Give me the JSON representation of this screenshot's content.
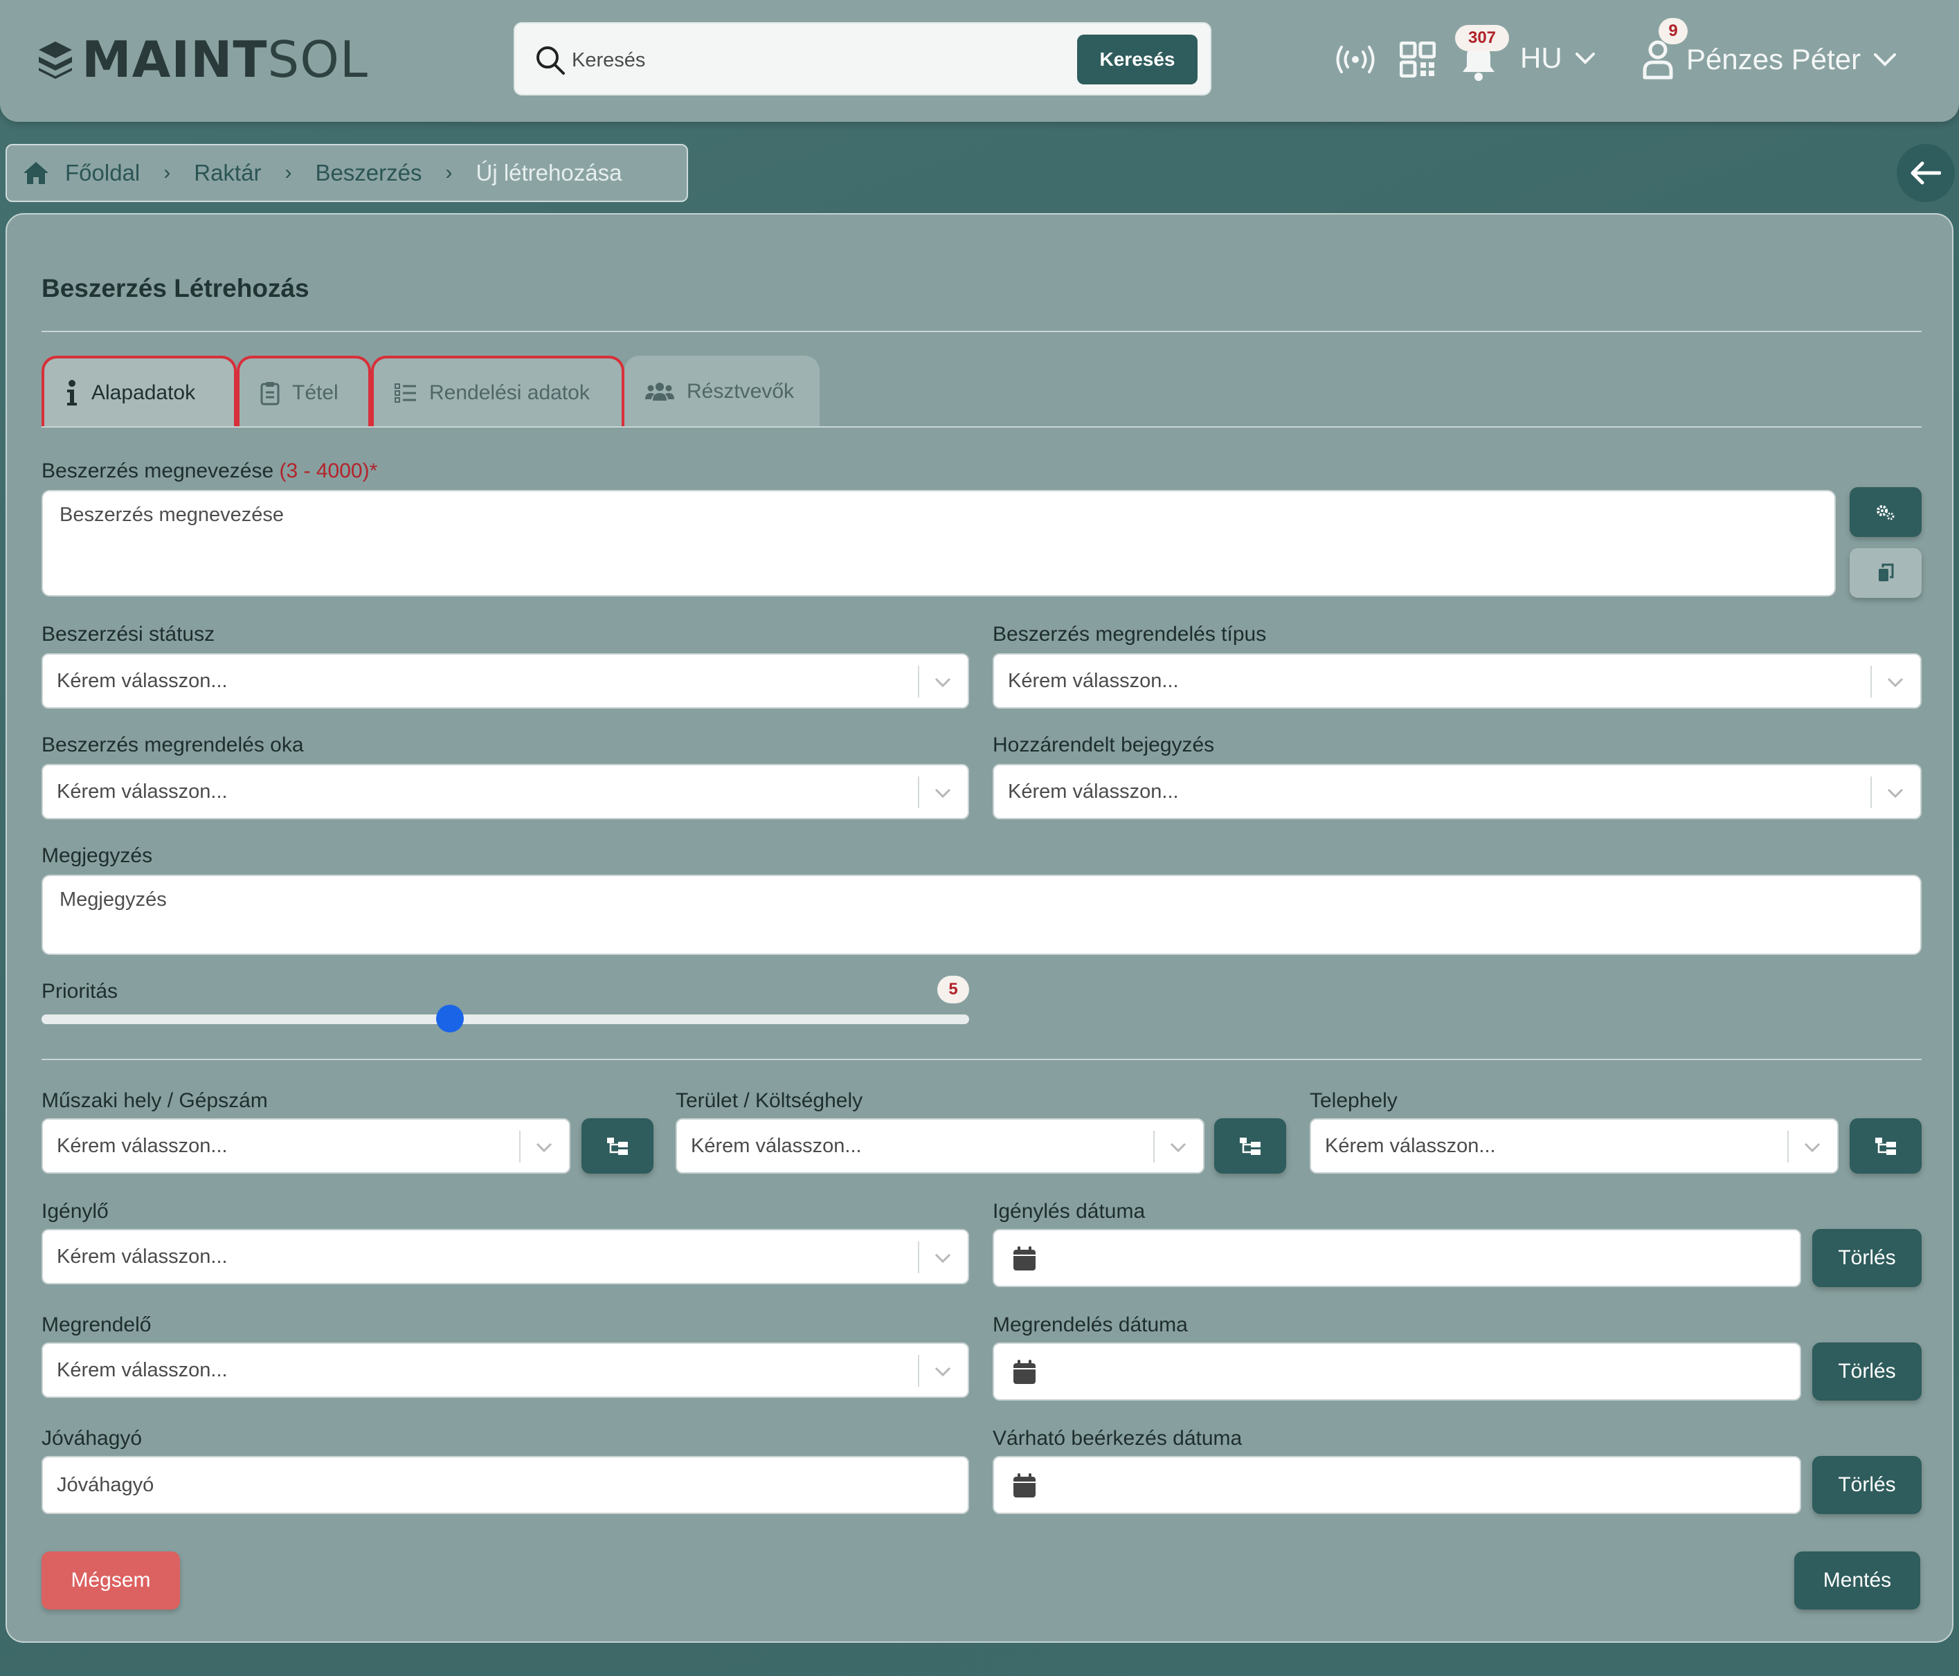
{
  "header": {
    "logo_bold": "MAINT",
    "logo_light": "SOL",
    "search_placeholder": "Keresés",
    "search_button": "Keresés",
    "notification_count": "307",
    "language": "HU",
    "user_badge": "9",
    "user_name": "Pénzes Péter"
  },
  "breadcrumb": {
    "items": [
      "Főoldal",
      "Raktár",
      "Beszerzés",
      "Új létrehozása"
    ]
  },
  "page": {
    "title": "Beszerzés Létrehozás"
  },
  "tabs": [
    {
      "label": "Alapadatok",
      "icon": "info-icon"
    },
    {
      "label": "Tétel",
      "icon": "clipboard-icon"
    },
    {
      "label": "Rendelési adatok",
      "icon": "list-icon"
    },
    {
      "label": "Résztvevők",
      "icon": "users-icon"
    }
  ],
  "form": {
    "name_label": "Beszerzés megnevezése",
    "name_hint": "(3 - 4000)*",
    "name_placeholder": "Beszerzés megnevezése",
    "status_label": "Beszerzési státusz",
    "order_type_label": "Beszerzés megrendelés típus",
    "order_reason_label": "Beszerzés megrendelés oka",
    "assigned_entry_label": "Hozzárendelt bejegyzés",
    "note_label": "Megjegyzés",
    "note_placeholder": "Megjegyzés",
    "priority_label": "Prioritás",
    "priority_value": "5",
    "priority_fraction": 0.44,
    "tech_place_label": "Műszaki hely / Gépszám",
    "area_label": "Terület / Költséghely",
    "site_label": "Telephely",
    "requester_label": "Igénylő",
    "request_date_label": "Igénylés dátuma",
    "orderer_label": "Megrendelő",
    "order_date_label": "Megrendelés dátuma",
    "approver_label": "Jóváhagyó",
    "approver_placeholder": "Jóváhagyó",
    "expected_date_label": "Várható beérkezés dátuma",
    "select_placeholder": "Kérem válasszon...",
    "clear_button": "Törlés"
  },
  "actions": {
    "cancel": "Mégsem",
    "save": "Mentés"
  },
  "colors": {
    "primary": "#2f5c5c",
    "danger": "#dc6161",
    "error_border": "#d7303a",
    "slider": "#1a64e8"
  }
}
